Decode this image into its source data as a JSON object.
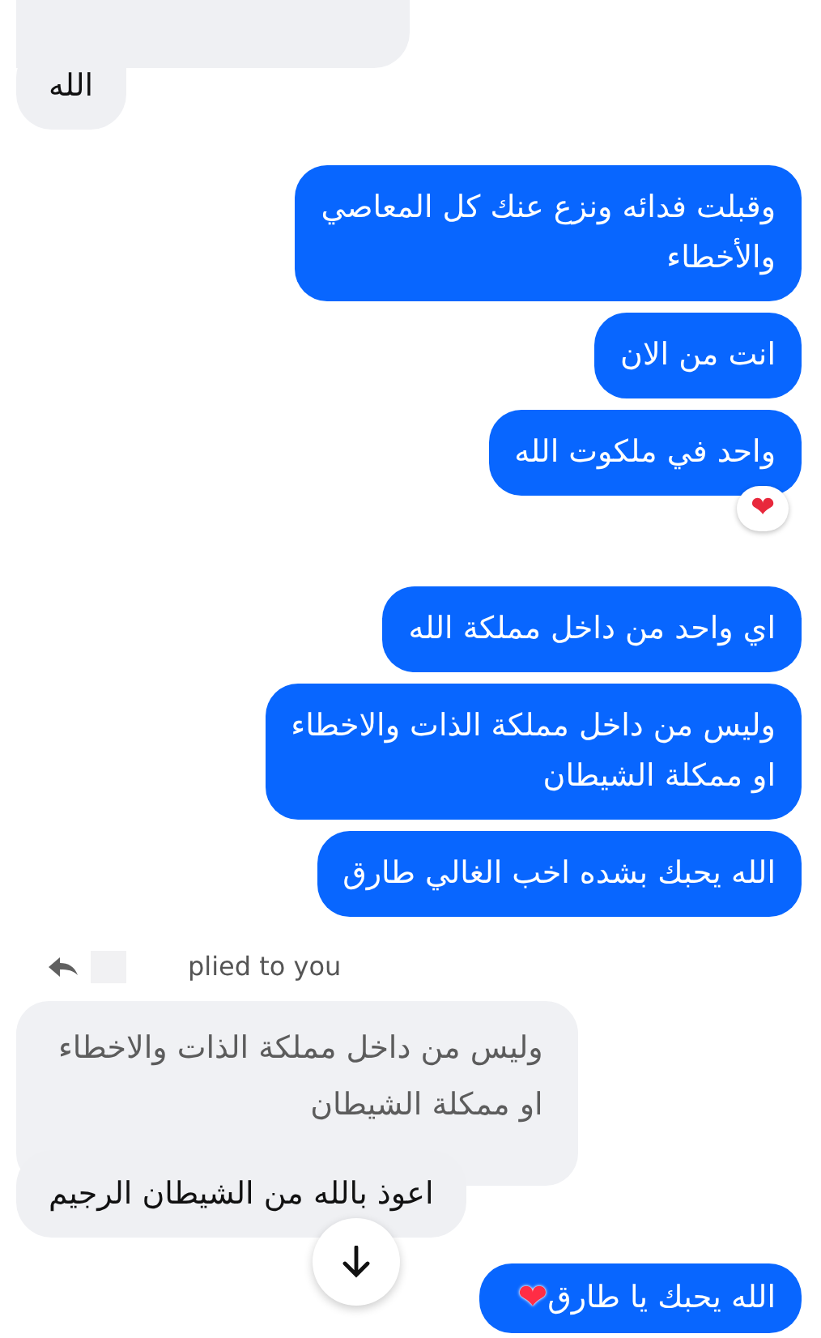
{
  "groups": [
    {
      "kind": "received",
      "cut_top": true,
      "bubbles": [
        {
          "text": "الله"
        }
      ]
    },
    {
      "kind": "sent",
      "bubbles": [
        {
          "text": "وقبلت فدائه ونزع عنك كل المعاصي\nوالأخطاء"
        },
        {
          "text": "انت من الان"
        },
        {
          "text": "واحد في ملكوت الله",
          "reaction": "❤"
        }
      ]
    },
    {
      "kind": "sent",
      "bubbles": [
        {
          "text": "اي واحد من داخل مملكة الله"
        },
        {
          "text": "وليس من داخل مملكة الذات والاخطاء\nاو ممكلة الشيطان"
        },
        {
          "text": "الله يحبك بشده اخب الغالي طارق"
        }
      ]
    },
    {
      "kind": "received",
      "reply_label": "plied to you",
      "quote": "وليس من داخل مملكة الذات والاخطاء\nاو ممكلة الشيطان",
      "bubbles": [
        {
          "text": "اعوذ بالله من الشيطان الرجيم"
        }
      ]
    },
    {
      "kind": "sent",
      "bubbles": [
        {
          "text": "الله يحبك يا طارق",
          "emoji": "❤"
        }
      ]
    }
  ]
}
